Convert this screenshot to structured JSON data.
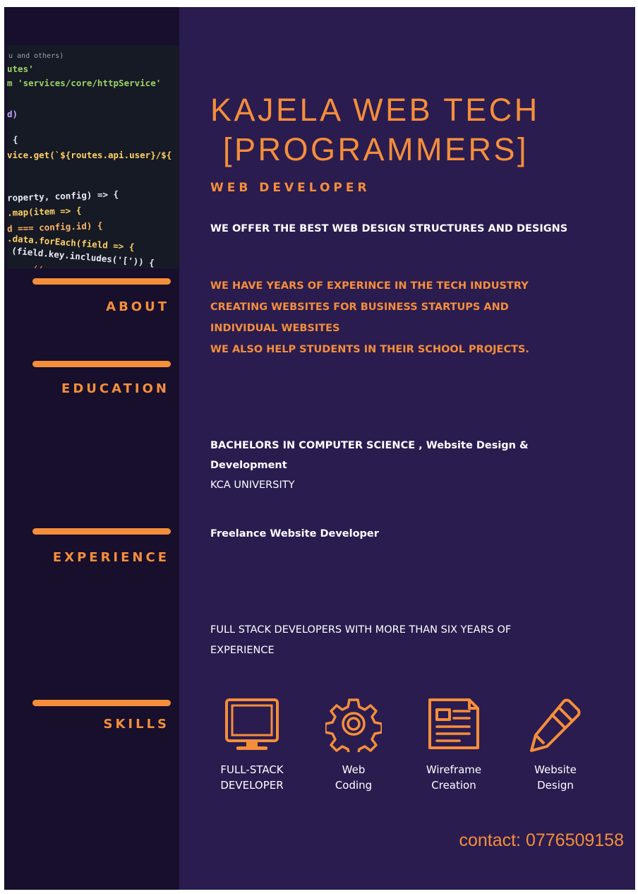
{
  "code_snippet": {
    "lines": [
      "u and others)",
      "utes'",
      "m 'services/core/httpService'",
      "",
      "d)",
      "",
      "{",
      "vice.get(`${routes.api.user}/${",
      "",
      "",
      "roperty, config) => {",
      ".map(item => {",
      "d === config.id) {",
      ".data.forEach(field => {",
      "(field.key.includes('[')) {",
      "  // ..."
    ]
  },
  "sidebar": {
    "sections": [
      "ABOUT",
      "EDUCATION",
      "EXPERIENCE",
      "SKILLS"
    ]
  },
  "header": {
    "title_line1": "KAJELA WEB TECH",
    "title_line2": "[PROGRAMMERS]",
    "subtitle": "WEB DEVELOPER",
    "tagline": "WE OFFER THE BEST WEB DESIGN STRUCTURES AND DESIGNS"
  },
  "about": {
    "lines": [
      "WE HAVE YEARS OF EXPERINCE IN THE TECH INDUSTRY",
      "CREATING WEBSITES FOR  BUSINESS STARTUPS AND",
      "INDIVIDUAL WEBSITES",
      "WE ALSO HELP STUDENTS IN THEIR SCHOOL PROJECTS."
    ]
  },
  "education": {
    "degree": "BACHELORS IN COMPUTER SCIENCE , Website Design & Development",
    "university": "KCA UNIVERSITY"
  },
  "experience": {
    "role": "Freelance Website Developer",
    "summary": "FULL STACK DEVELOPERS  WITH MORE THAN SIX YEARS OF EXPERIENCE"
  },
  "skills": [
    {
      "icon": "monitor-icon",
      "line1": "FULL-STACK",
      "line2": "DEVELOPER"
    },
    {
      "icon": "gear-icon",
      "line1": "Web",
      "line2": "Coding"
    },
    {
      "icon": "document-icon",
      "line1": "Wireframe",
      "line2": "Creation"
    },
    {
      "icon": "pencil-icon",
      "line1": "Website",
      "line2": "Design"
    }
  ],
  "contact": "contact: 0776509158",
  "colors": {
    "background": "#2a1c4f",
    "sidebar": "#170f2b",
    "accent": "#f58e3b",
    "text": "#ffffff"
  }
}
